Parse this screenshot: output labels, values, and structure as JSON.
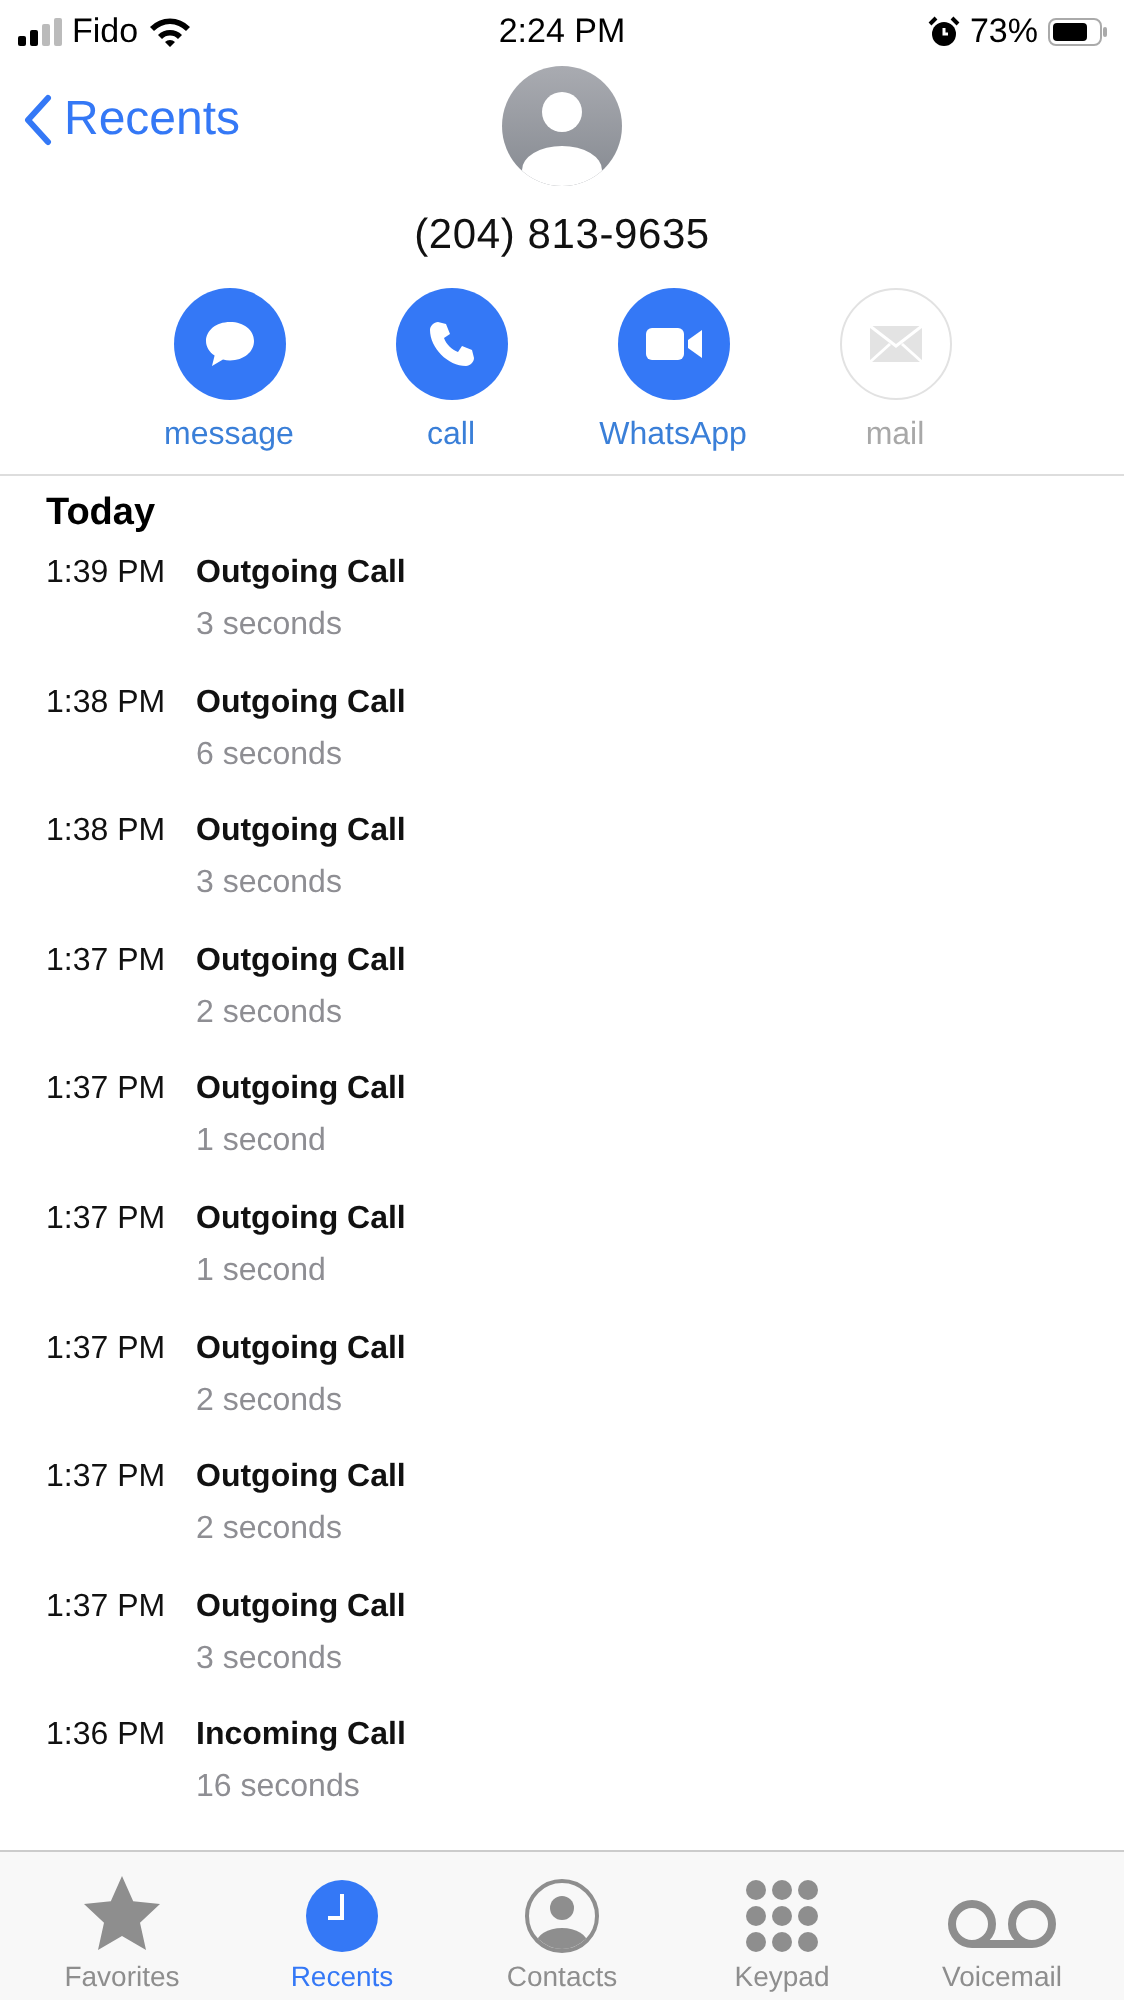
{
  "status_bar": {
    "carrier": "Fido",
    "time": "2:24 PM",
    "battery": "73%",
    "alarm": true
  },
  "nav": {
    "back": "Recents"
  },
  "contact": {
    "number": "(204) 813-9635"
  },
  "actions": [
    {
      "kind": "message",
      "label": "message",
      "disabled": false
    },
    {
      "kind": "call",
      "label": "call",
      "disabled": false
    },
    {
      "kind": "video",
      "label": "WhatsApp",
      "disabled": false
    },
    {
      "kind": "mail",
      "label": "mail",
      "disabled": true
    }
  ],
  "section": "Today",
  "calls": [
    {
      "time": "1:39 PM",
      "type": "Outgoing Call",
      "duration": "3 seconds"
    },
    {
      "time": "1:38 PM",
      "type": "Outgoing Call",
      "duration": "6 seconds"
    },
    {
      "time": "1:38 PM",
      "type": "Outgoing Call",
      "duration": "3 seconds"
    },
    {
      "time": "1:37 PM",
      "type": "Outgoing Call",
      "duration": "2 seconds"
    },
    {
      "time": "1:37 PM",
      "type": "Outgoing Call",
      "duration": "1 second"
    },
    {
      "time": "1:37 PM",
      "type": "Outgoing Call",
      "duration": "1 second"
    },
    {
      "time": "1:37 PM",
      "type": "Outgoing Call",
      "duration": "2 seconds"
    },
    {
      "time": "1:37 PM",
      "type": "Outgoing Call",
      "duration": "2 seconds"
    },
    {
      "time": "1:37 PM",
      "type": "Outgoing Call",
      "duration": "3 seconds"
    },
    {
      "time": "1:36 PM",
      "type": "Incoming Call",
      "duration": "16 seconds"
    }
  ],
  "tabs": [
    {
      "kind": "favorites",
      "label": "Favorites",
      "selected": false
    },
    {
      "kind": "recents",
      "label": "Recents",
      "selected": true
    },
    {
      "kind": "contacts",
      "label": "Contacts",
      "selected": false
    },
    {
      "kind": "keypad",
      "label": "Keypad",
      "selected": false
    },
    {
      "kind": "voicemail",
      "label": "Voicemail",
      "selected": false
    }
  ]
}
